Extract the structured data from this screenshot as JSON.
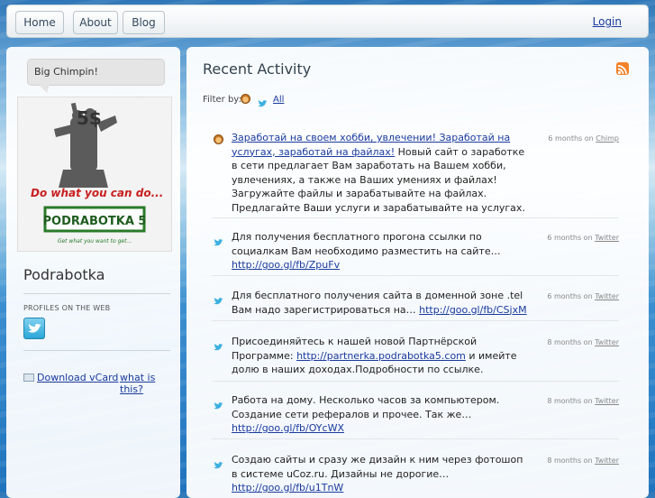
{
  "nav": {
    "items": [
      "Home",
      "About",
      "Blog"
    ],
    "login": "Login"
  },
  "sidebar": {
    "status": "Big Chimpin!",
    "avatar": {
      "price": "5$",
      "slogan": "Do what you can do...",
      "banner": "PODRABOTKA 5",
      "tagline": "Get what you want to get..."
    },
    "name": "Podrabotka",
    "profiles_label": "PROFILES ON THE WEB",
    "vcard_label": "Download vCard",
    "whatis_label": "what is this?"
  },
  "activity": {
    "title": "Recent Activity",
    "filter_label": "Filter by:",
    "filter_all": "All",
    "items": [
      {
        "source": "chimp",
        "link": "Заработай на своем хобби, увлечении! Заработай на услугах, заработай на файлах!",
        "text": " Новый сайт о заработке в сети предлагает Вам заработать на Вашем хобби, увлечениях, а также на Ваших умениях и файлах! Загружайте файлы и зарабатывайте на файлах. Предлагайте Ваши услуги и зарабатывайте на услугах.",
        "url": "",
        "time": "6 months on",
        "service": "Chimp"
      },
      {
        "source": "twitter",
        "link": "",
        "text": "Для получения бесплатного прогона ссылки по социалкам Вам необходимо разместить на сайте… ",
        "url": "http://goo.gl/fb/ZpuFv",
        "time": "6 months on",
        "service": "Twitter"
      },
      {
        "source": "twitter",
        "link": "",
        "text": "Для бесплатного получения сайта в доменной зоне .tel Вам надо зарегистрироваться на… ",
        "url": "http://goo.gl/fb/CSjxM",
        "time": "6 months on",
        "service": "Twitter"
      },
      {
        "source": "twitter",
        "link": "",
        "text": "Присоединяйтесь к нашей новой Партнёрской Программе: ",
        "url": "http://partnerka.podrabotka5.com",
        "text2": " и имейте долю в наших доходах.Подробности по ссылке.",
        "time": "8 months on",
        "service": "Twitter"
      },
      {
        "source": "twitter",
        "link": "",
        "text": "Работа на дому. Несколько часов за компьютером. Создание сети рефералов и прочее. Так же… ",
        "url": "http://goo.gl/fb/OYcWX",
        "time": "8 months on",
        "service": "Twitter"
      },
      {
        "source": "twitter",
        "link": "",
        "text": "Создаю сайты и сразу же дизайн к ним через фотошоп в системе uCoz.ru. Дизайны не дорогие… ",
        "url": "http://goo.gl/fb/u1TnW",
        "time": "8 months on",
        "service": "Twitter"
      }
    ]
  },
  "colors": {
    "link": "#1a3a9e",
    "rss": "#f2822a",
    "twitter": "#2aa6d8"
  }
}
